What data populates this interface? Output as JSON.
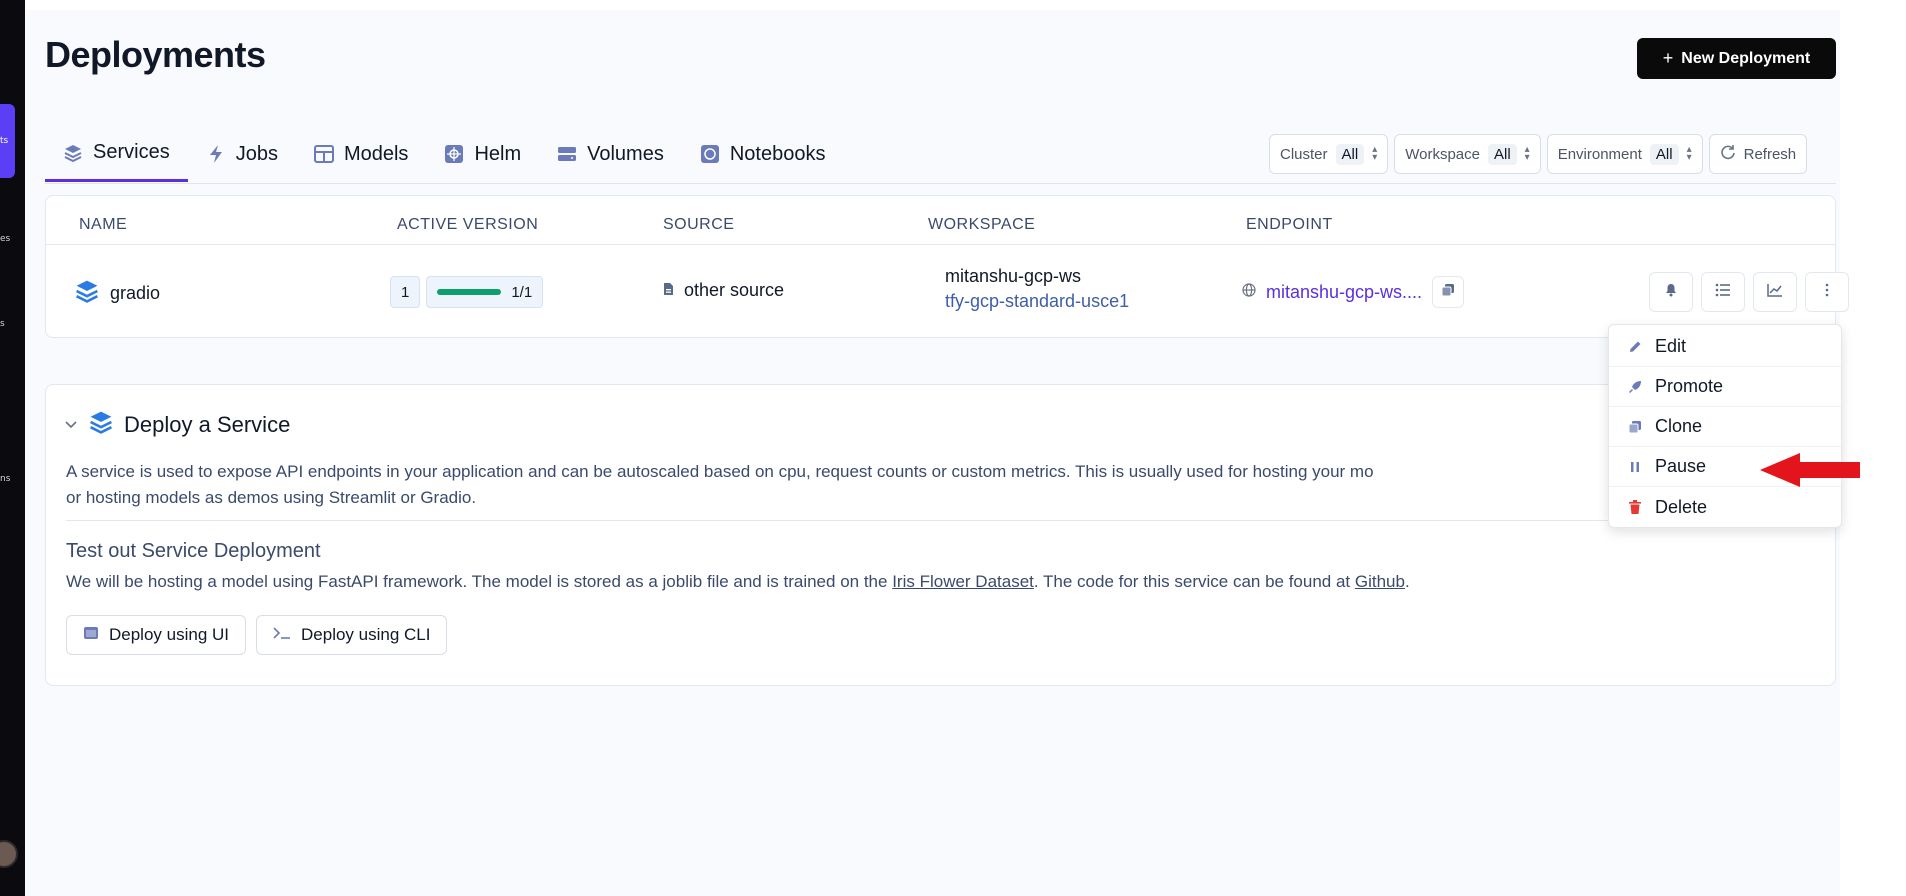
{
  "sidebar": {
    "fragments": [
      "ts",
      "es",
      "s",
      "ns"
    ]
  },
  "header": {
    "title": "Deployments",
    "new_button": "New Deployment"
  },
  "tabs": [
    {
      "label": "Services",
      "icon": "stack-icon"
    },
    {
      "label": "Jobs",
      "icon": "lightning-icon"
    },
    {
      "label": "Models",
      "icon": "table-icon"
    },
    {
      "label": "Helm",
      "icon": "helm-icon"
    },
    {
      "label": "Volumes",
      "icon": "volume-icon"
    },
    {
      "label": "Notebooks",
      "icon": "notebook-icon"
    }
  ],
  "filters": {
    "cluster_label": "Cluster",
    "cluster_value": "All",
    "workspace_label": "Workspace",
    "workspace_value": "All",
    "environment_label": "Environment",
    "environment_value": "All",
    "refresh_label": "Refresh"
  },
  "table": {
    "headers": [
      "NAME",
      "ACTIVE VERSION",
      "SOURCE",
      "WORKSPACE",
      "ENDPOINT"
    ],
    "row": {
      "name": "gradio",
      "version": "1",
      "replicas": "1/1",
      "source": "other source",
      "workspace": "mitanshu-gcp-ws",
      "cluster": "tfy-gcp-standard-usce1",
      "endpoint": "mitanshu-gcp-ws...."
    }
  },
  "menu": {
    "items": [
      "Edit",
      "Promote",
      "Clone",
      "Pause",
      "Delete"
    ]
  },
  "deploy": {
    "title": "Deploy a Service",
    "desc_line1": "A service is used to expose API endpoints in your application and can be autoscaled based on cpu, request counts or custom metrics. This is usually used for hosting your mo",
    "desc_line2": "or hosting models as demos using Streamlit or Gradio.",
    "test_title": "Test out Service Deployment",
    "test_desc_pre": "We will be hosting a model using FastAPI framework. The model is stored as a joblib file and is trained on the ",
    "test_link1": "Iris Flower Dataset",
    "test_desc_mid": ". The code for this service can be found at ",
    "test_link2": "Github",
    "test_desc_end": ".",
    "btn_ui": "Deploy using UI",
    "btn_cli": "Deploy using CLI"
  },
  "colors": {
    "accent": "#5b2ee0",
    "sidebar_active": "#5b3ff6",
    "success": "#0e9f6e",
    "danger": "#e53935",
    "annotation_arrow": "#e3141b"
  }
}
